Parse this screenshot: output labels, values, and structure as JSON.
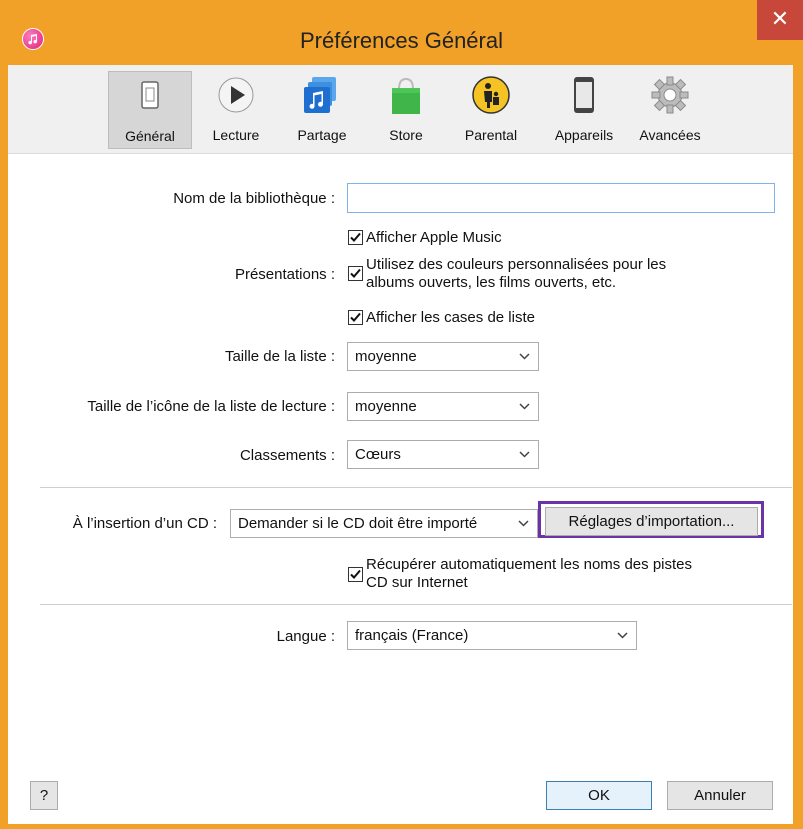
{
  "window": {
    "title": "Préférences Général",
    "close_symbol": "✕"
  },
  "toolbar": {
    "items": [
      {
        "label": "Général",
        "icon": "general-icon"
      },
      {
        "label": "Lecture",
        "icon": "play-icon"
      },
      {
        "label": "Partage",
        "icon": "sharing-icon"
      },
      {
        "label": "Store",
        "icon": "store-bag-icon"
      },
      {
        "label": "Parental",
        "icon": "parental-icon"
      },
      {
        "label": "Appareils",
        "icon": "device-icon"
      },
      {
        "label": "Avancées",
        "icon": "gear-icon"
      }
    ],
    "selected": "Général"
  },
  "form": {
    "library_name_label": "Nom de la bibliothèque :",
    "library_name_value": "",
    "presentations_label": "Présentations :",
    "show_apple_music_label": "Afficher Apple Music",
    "custom_colors_line1": "Utilisez des couleurs personnalisées pour les",
    "custom_colors_line2": "albums ouverts, les films ouverts, etc.",
    "show_list_checkboxes_label": "Afficher les cases de liste",
    "list_size_label": "Taille de la liste :",
    "list_size_value": "moyenne",
    "playlist_icon_size_label": "Taille de l’icône de la liste de lecture :",
    "playlist_icon_size_value": "moyenne",
    "ratings_label": "Classements :",
    "ratings_value": "Cœurs",
    "cd_insert_label": "À l’insertion d’un CD :",
    "cd_insert_value": "Demander si le CD doit être importé",
    "import_settings_button": "Réglages d’importation...",
    "fetch_track_names_line1": "Récupérer automatiquement les noms des pistes",
    "fetch_track_names_line2": "CD sur Internet",
    "language_label": "Langue :",
    "language_value": "français (France)"
  },
  "checkboxes": {
    "show_apple_music": true,
    "custom_colors": true,
    "show_list_checkboxes": true,
    "fetch_track_names": true
  },
  "footer": {
    "help_label": "?",
    "ok_label": "OK",
    "cancel_label": "Annuler"
  },
  "colors": {
    "window_frame": "#f1a128",
    "close_button": "#c7473a",
    "focus_highlight": "#6b33a8",
    "textbox_border": "#7eb4ea"
  }
}
